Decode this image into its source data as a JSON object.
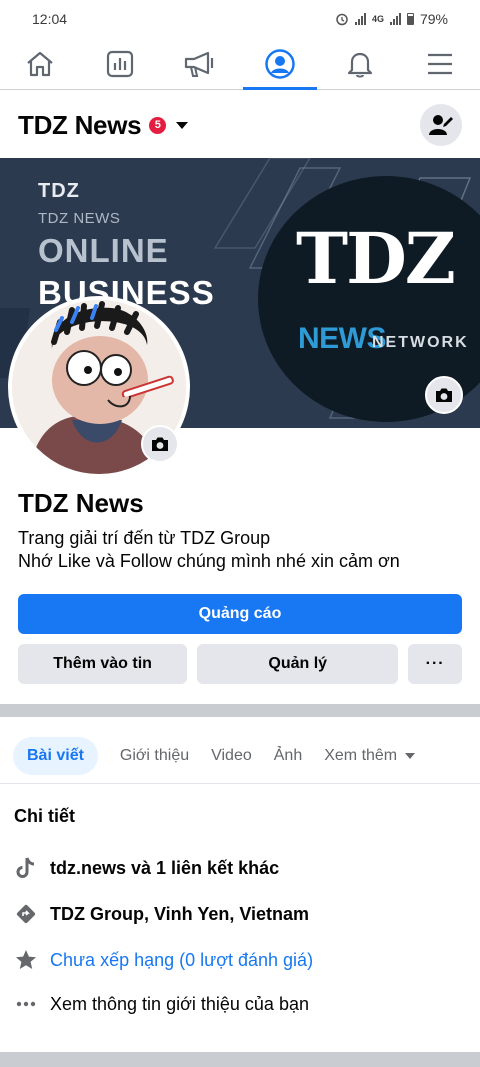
{
  "status_bar": {
    "time": "12:04",
    "network": "4G",
    "battery": "79%"
  },
  "nav": {
    "tabs": [
      "home",
      "insights",
      "ads",
      "profile",
      "notifications",
      "menu"
    ],
    "active": "profile"
  },
  "header": {
    "title": "TDZ News",
    "badge_count": "5"
  },
  "cover": {
    "logo_small": "TDZ",
    "sub": "TDZ NEWS",
    "line1": "ONLINE",
    "line2": "BUSINESS",
    "brand": "TDZ",
    "news": "NEWS",
    "network": "NETWORK"
  },
  "page": {
    "name": "TDZ News",
    "bio_line1": "Trang giải trí đến từ TDZ Group",
    "bio_line2": "Nhớ Like và Follow chúng mình nhé xin cảm ơn"
  },
  "actions": {
    "primary": "Quảng cáo",
    "add_story": "Thêm vào tin",
    "manage": "Quản lý",
    "more": "···"
  },
  "tabs": [
    "Bài viết",
    "Giới thiệu",
    "Video",
    "Ảnh",
    "Xem thêm"
  ],
  "details": {
    "title": "Chi tiết",
    "items": [
      {
        "icon": "tiktok-icon",
        "text": "tdz.news và 1 liên kết khác"
      },
      {
        "icon": "location-icon",
        "text": "TDZ Group, Vinh Yen, Vietnam"
      },
      {
        "icon": "star-icon",
        "text": "Chưa xếp hạng (0 lượt đánh giá)"
      },
      {
        "icon": "more-dots-icon",
        "text": "Xem thông tin giới thiệu của bạn"
      }
    ]
  },
  "colors": {
    "accent": "#1877f2",
    "badge": "#e41e3f",
    "cover_bg": "#2b3a4f"
  }
}
